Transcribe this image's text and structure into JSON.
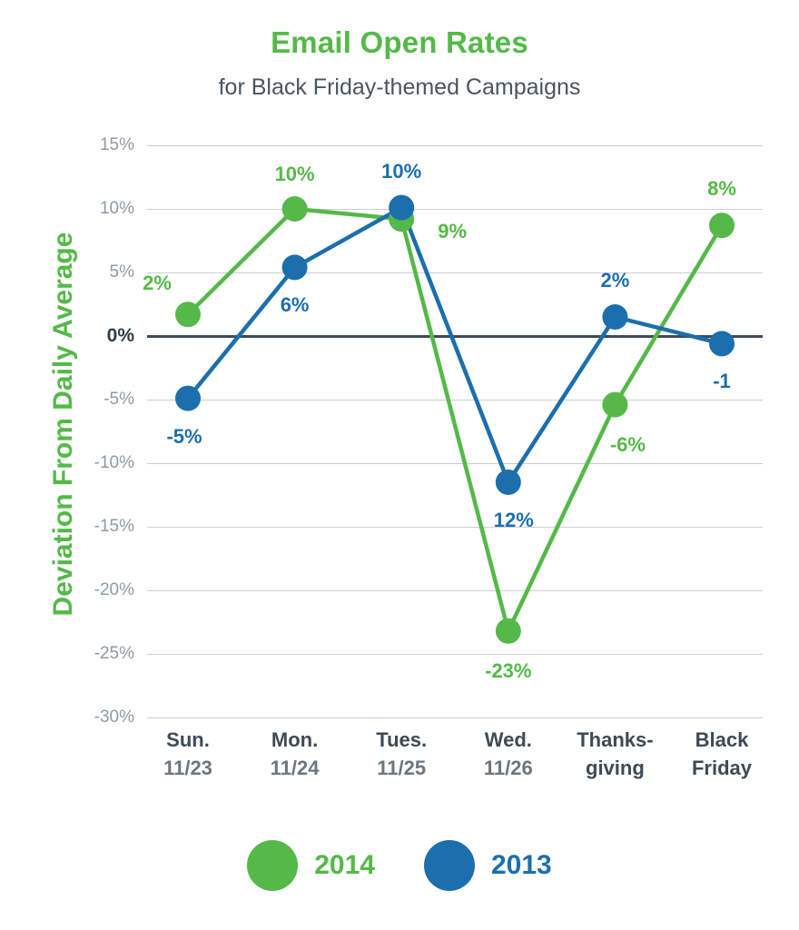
{
  "header": {
    "title": "Email Open Rates",
    "subtitle": "for Black Friday-themed Campaigns"
  },
  "colors": {
    "green": "#54b948",
    "blue": "#1b6fad",
    "grid": "#c9cfd4",
    "zero_line": "#3d4a57",
    "tick_text": "#8e9ba6",
    "subtitle_text": "#4a5560"
  },
  "legend": {
    "position": "bottom-center",
    "items": [
      {
        "label": "2014",
        "color": "#54b948",
        "icon": "circle-swatch"
      },
      {
        "label": "2013",
        "color": "#1b6fad",
        "icon": "circle-swatch"
      }
    ]
  },
  "chart_data": {
    "type": "line",
    "title": "Email Open Rates",
    "subtitle": "for Black Friday-themed Campaigns",
    "xlabel": "",
    "ylabel": "Deviation From Daily Average",
    "ylim": [
      -30,
      15
    ],
    "yticks": [
      15,
      10,
      5,
      0,
      -5,
      -10,
      -15,
      -20,
      -25,
      -30
    ],
    "ytick_labels": [
      "15%",
      "10%",
      "5%",
      "0%",
      "-5%",
      "-10%",
      "-15%",
      "-20%",
      "-25%",
      "-30%"
    ],
    "grid": true,
    "zero_line": true,
    "categories": [
      {
        "line1": "Sun.",
        "line2": "11/23"
      },
      {
        "line1": "Mon.",
        "line2": "11/24"
      },
      {
        "line1": "Tues.",
        "line2": "11/25"
      },
      {
        "line1": "Wed.",
        "line2": "11/26"
      },
      {
        "line1": "Thanks-",
        "line2": "giving"
      },
      {
        "line1": "Black",
        "line2": "Friday"
      }
    ],
    "series": [
      {
        "name": "2014",
        "color": "#54b948",
        "values": [
          1.7,
          10.0,
          9.2,
          -23.2,
          -5.4,
          8.7
        ],
        "point_labels": [
          "2%",
          "10%",
          "9%",
          "-23%",
          "-6%",
          "8%"
        ]
      },
      {
        "name": "2013",
        "color": "#1b6fad",
        "values": [
          -4.9,
          5.4,
          10.1,
          -11.5,
          1.5,
          -0.6
        ],
        "point_labels": [
          "-5%",
          "6%",
          "10%",
          "12%",
          "2%",
          "-1"
        ]
      }
    ]
  }
}
